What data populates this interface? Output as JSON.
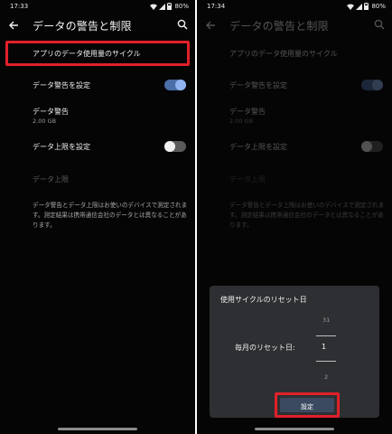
{
  "left": {
    "status": {
      "time": "17:33",
      "battery": "80%"
    },
    "appbar": {
      "title": "データの警告と制限"
    },
    "cycle": {
      "label": "アプリのデータ使用量のサイクル"
    },
    "warning_toggle": {
      "label": "データ警告を設定",
      "state": "on"
    },
    "warning": {
      "label": "データ警告",
      "value": "2.00 GB"
    },
    "limit_toggle": {
      "label": "データ上限を設定",
      "state": "off"
    },
    "limit": {
      "label": "データ上限"
    },
    "description": "データ警告とデータ上限はお使いのデバイスで測定されます。測定結果は携帯通信会社のデータとは異なることがあります。"
  },
  "right": {
    "status": {
      "time": "17:34",
      "battery": "80%"
    },
    "appbar": {
      "title": "データの警告と制限"
    },
    "cycle": {
      "label": "アプリのデータ使用量のサイクル"
    },
    "warning_toggle": {
      "label": "データ警告を設定",
      "state": "on"
    },
    "warning": {
      "label": "データ警告",
      "value": "2.00 GB"
    },
    "limit_toggle": {
      "label": "データ上限を設定",
      "state": "off"
    },
    "limit": {
      "label": "データ上限"
    },
    "description": "データ警告とデータ上限はお使いのデバイスで測定されます。測定結果は携帯通信会社のデータとは異なることがあります。",
    "dialog": {
      "title": "使用サイクルのリセット日",
      "picker_label": "毎月のリセット日:",
      "prev_value": "31",
      "current_value": "1",
      "next_value": "2",
      "button_label": "設定"
    }
  },
  "colors": {
    "highlight": "#e0202a",
    "toggle_on": "#8fb4f0",
    "background": "#050505",
    "dialog": "#2e2f32"
  }
}
